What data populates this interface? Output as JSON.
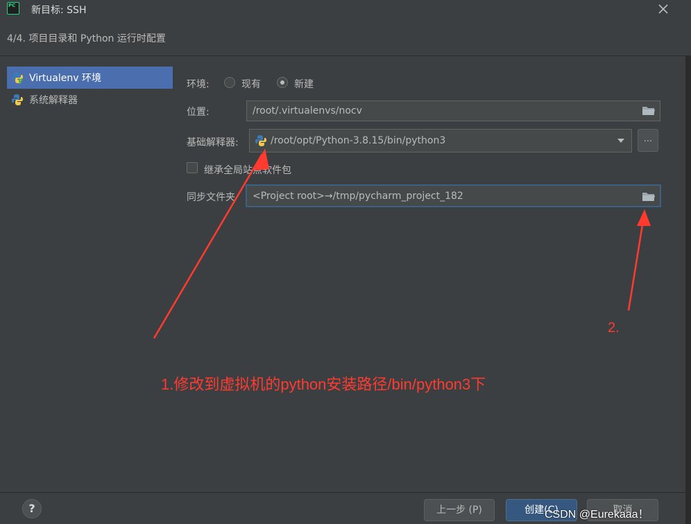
{
  "window": {
    "app_icon_label": "PC",
    "title": "新目标: SSH",
    "subtitle": "4/4. 项目目录和 Python 运行时配置"
  },
  "sidebar": {
    "items": [
      {
        "label": "Virtualenv 环境",
        "icon": "virtualenv-icon",
        "selected": true
      },
      {
        "label": "系统解释器",
        "icon": "python-icon",
        "selected": false
      }
    ]
  },
  "form": {
    "environment": {
      "label": "环境:",
      "options": [
        {
          "label": "现有",
          "checked": false
        },
        {
          "label": "新建",
          "checked": true
        }
      ]
    },
    "location": {
      "label": "位置:",
      "value": "/root/.virtualenvs/nocv"
    },
    "base_interpreter": {
      "label": "基础解释器:",
      "value": "/root/opt/Python-3.8.15/bin/python3",
      "more_button": "..."
    },
    "inherit_packages": {
      "label": "继承全局站点软件包",
      "checked": false
    },
    "sync_folder": {
      "label": "同步文件夹",
      "value": "<Project root>→/tmp/pycharm_project_182"
    }
  },
  "annotations": {
    "note1": "1.修改到虚拟机的python安装路径/bin/python3下",
    "note2": "2.",
    "color": "#ff3b30"
  },
  "footer": {
    "help": "?",
    "prev": "上一步 (P)",
    "create": "创建(C)",
    "cancel": "取消"
  },
  "watermark": "CSDN @Eurekaaa！"
}
